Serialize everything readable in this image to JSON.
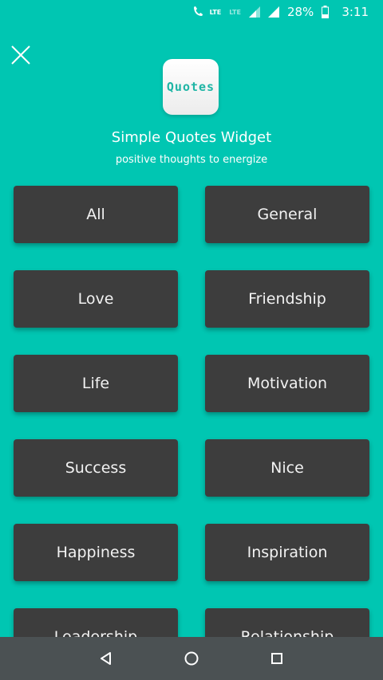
{
  "status_bar": {
    "lte_label": "LTE",
    "lte_small_label": "LTE",
    "battery": "28%",
    "time": "3:11",
    "icons": [
      "phone-lte-icon",
      "signal-icon",
      "signal-icon",
      "battery-icon"
    ]
  },
  "header": {
    "logo_text": "Quotes",
    "title": "Simple Quotes Widget",
    "subtitle": "positive thoughts to energize"
  },
  "categories": [
    "All",
    "General",
    "Love",
    "Friendship",
    "Life",
    "Motivation",
    "Success",
    "Nice",
    "Happiness",
    "Inspiration",
    "Leadership",
    "Relationship"
  ],
  "colors": {
    "background": "#00c6b2",
    "button": "#3d3d3d",
    "navbar": "#4b5153",
    "logo_text": "#1fb5a5"
  },
  "navbar": {
    "icons": [
      "back-icon",
      "home-icon",
      "recents-icon"
    ]
  }
}
